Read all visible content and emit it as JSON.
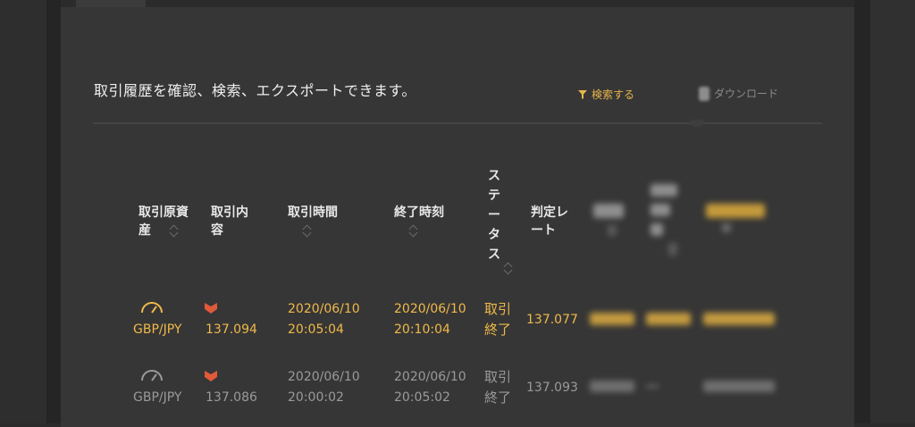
{
  "page": {
    "intro": "取引履歴を確認、検索、エクスポートできます。",
    "search_label": "検索する",
    "download_label": "ダウンロード"
  },
  "table": {
    "headers": {
      "asset": [
        "取引原資",
        "産"
      ],
      "content": [
        "取引内",
        "容"
      ],
      "trade_time": "取引時間",
      "end_time": "終了時刻",
      "status": [
        "ス",
        "テ",
        "ー",
        "タ",
        "ス"
      ],
      "rate": [
        "判定レ",
        "ート"
      ]
    },
    "rows": [
      {
        "highlighted": true,
        "asset": "GBP/JPY",
        "content_value": "137.094",
        "trade_date": "2020/06/10",
        "trade_time": "20:05:04",
        "end_date": "2020/06/10",
        "end_time": "20:10:04",
        "status": [
          "取引",
          "終了"
        ],
        "rate": "137.077"
      },
      {
        "highlighted": false,
        "asset": "GBP/JPY",
        "content_value": "137.086",
        "trade_date": "2020/06/10",
        "trade_time": "20:00:02",
        "end_date": "2020/06/10",
        "end_time": "20:05:02",
        "status": [
          "取引",
          "終了"
        ],
        "rate": "137.093"
      }
    ]
  },
  "colors": {
    "background": "#363636",
    "accent": "#f0b94a",
    "direction_icon": "#e05a3a",
    "muted": "#9a9a9a"
  },
  "icons": {
    "filter": "filter-icon",
    "download": "download-icon",
    "gauge": "gauge-icon",
    "direction": "direction-down-icon"
  }
}
